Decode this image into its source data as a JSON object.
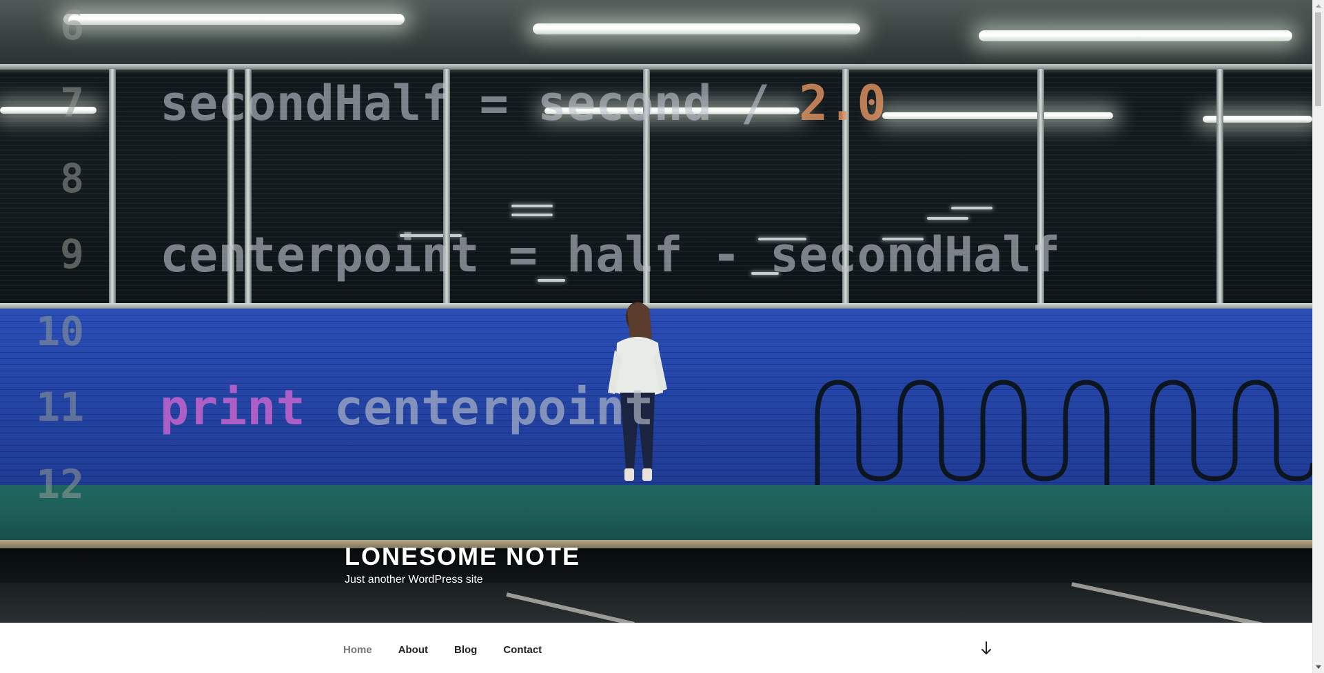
{
  "site": {
    "title": "LONESOME NOTE",
    "description": "Just another WordPress site"
  },
  "hero": {
    "code_lines": [
      {
        "number": "6",
        "code": ""
      },
      {
        "number": "7",
        "code": "secondHalf = second / ",
        "number_literal": "2.0"
      },
      {
        "number": "8",
        "code": ""
      },
      {
        "number": "9",
        "code": "centerpoint = half - secondHalf"
      },
      {
        "number": "10",
        "code": ""
      },
      {
        "number": "11",
        "keyword": "print",
        "code": " centerpoint"
      },
      {
        "number": "12",
        "code": ""
      }
    ],
    "colors": {
      "code_text": "#bec3cd",
      "number_literal": "#e0915f",
      "keyword": "#c664cd",
      "wall": "#2546a8"
    }
  },
  "navigation": {
    "items": [
      {
        "label": "Home",
        "current": true
      },
      {
        "label": "About",
        "current": false
      },
      {
        "label": "Blog",
        "current": false
      },
      {
        "label": "Contact",
        "current": false
      }
    ],
    "scroll_icon": "arrow-down-icon"
  },
  "scrollbar": {
    "up_icon": "scroll-up-arrow-icon",
    "down_icon": "scroll-down-arrow-icon"
  }
}
